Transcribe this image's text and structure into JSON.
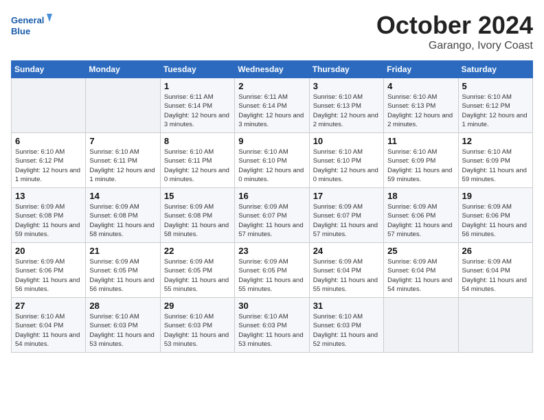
{
  "logo": {
    "text_general": "General",
    "text_blue": "Blue"
  },
  "title": {
    "month": "October 2024",
    "location": "Garango, Ivory Coast"
  },
  "headers": [
    "Sunday",
    "Monday",
    "Tuesday",
    "Wednesday",
    "Thursday",
    "Friday",
    "Saturday"
  ],
  "weeks": [
    [
      {
        "day": "",
        "content": ""
      },
      {
        "day": "",
        "content": ""
      },
      {
        "day": "1",
        "content": "Sunrise: 6:11 AM\nSunset: 6:14 PM\nDaylight: 12 hours and 3 minutes."
      },
      {
        "day": "2",
        "content": "Sunrise: 6:11 AM\nSunset: 6:14 PM\nDaylight: 12 hours and 3 minutes."
      },
      {
        "day": "3",
        "content": "Sunrise: 6:10 AM\nSunset: 6:13 PM\nDaylight: 12 hours and 2 minutes."
      },
      {
        "day": "4",
        "content": "Sunrise: 6:10 AM\nSunset: 6:13 PM\nDaylight: 12 hours and 2 minutes."
      },
      {
        "day": "5",
        "content": "Sunrise: 6:10 AM\nSunset: 6:12 PM\nDaylight: 12 hours and 1 minute."
      }
    ],
    [
      {
        "day": "6",
        "content": "Sunrise: 6:10 AM\nSunset: 6:12 PM\nDaylight: 12 hours and 1 minute."
      },
      {
        "day": "7",
        "content": "Sunrise: 6:10 AM\nSunset: 6:11 PM\nDaylight: 12 hours and 1 minute."
      },
      {
        "day": "8",
        "content": "Sunrise: 6:10 AM\nSunset: 6:11 PM\nDaylight: 12 hours and 0 minutes."
      },
      {
        "day": "9",
        "content": "Sunrise: 6:10 AM\nSunset: 6:10 PM\nDaylight: 12 hours and 0 minutes."
      },
      {
        "day": "10",
        "content": "Sunrise: 6:10 AM\nSunset: 6:10 PM\nDaylight: 12 hours and 0 minutes."
      },
      {
        "day": "11",
        "content": "Sunrise: 6:10 AM\nSunset: 6:09 PM\nDaylight: 11 hours and 59 minutes."
      },
      {
        "day": "12",
        "content": "Sunrise: 6:10 AM\nSunset: 6:09 PM\nDaylight: 11 hours and 59 minutes."
      }
    ],
    [
      {
        "day": "13",
        "content": "Sunrise: 6:09 AM\nSunset: 6:08 PM\nDaylight: 11 hours and 59 minutes."
      },
      {
        "day": "14",
        "content": "Sunrise: 6:09 AM\nSunset: 6:08 PM\nDaylight: 11 hours and 58 minutes."
      },
      {
        "day": "15",
        "content": "Sunrise: 6:09 AM\nSunset: 6:08 PM\nDaylight: 11 hours and 58 minutes."
      },
      {
        "day": "16",
        "content": "Sunrise: 6:09 AM\nSunset: 6:07 PM\nDaylight: 11 hours and 57 minutes."
      },
      {
        "day": "17",
        "content": "Sunrise: 6:09 AM\nSunset: 6:07 PM\nDaylight: 11 hours and 57 minutes."
      },
      {
        "day": "18",
        "content": "Sunrise: 6:09 AM\nSunset: 6:06 PM\nDaylight: 11 hours and 57 minutes."
      },
      {
        "day": "19",
        "content": "Sunrise: 6:09 AM\nSunset: 6:06 PM\nDaylight: 11 hours and 56 minutes."
      }
    ],
    [
      {
        "day": "20",
        "content": "Sunrise: 6:09 AM\nSunset: 6:06 PM\nDaylight: 11 hours and 56 minutes."
      },
      {
        "day": "21",
        "content": "Sunrise: 6:09 AM\nSunset: 6:05 PM\nDaylight: 11 hours and 56 minutes."
      },
      {
        "day": "22",
        "content": "Sunrise: 6:09 AM\nSunset: 6:05 PM\nDaylight: 11 hours and 55 minutes."
      },
      {
        "day": "23",
        "content": "Sunrise: 6:09 AM\nSunset: 6:05 PM\nDaylight: 11 hours and 55 minutes."
      },
      {
        "day": "24",
        "content": "Sunrise: 6:09 AM\nSunset: 6:04 PM\nDaylight: 11 hours and 55 minutes."
      },
      {
        "day": "25",
        "content": "Sunrise: 6:09 AM\nSunset: 6:04 PM\nDaylight: 11 hours and 54 minutes."
      },
      {
        "day": "26",
        "content": "Sunrise: 6:09 AM\nSunset: 6:04 PM\nDaylight: 11 hours and 54 minutes."
      }
    ],
    [
      {
        "day": "27",
        "content": "Sunrise: 6:10 AM\nSunset: 6:04 PM\nDaylight: 11 hours and 54 minutes."
      },
      {
        "day": "28",
        "content": "Sunrise: 6:10 AM\nSunset: 6:03 PM\nDaylight: 11 hours and 53 minutes."
      },
      {
        "day": "29",
        "content": "Sunrise: 6:10 AM\nSunset: 6:03 PM\nDaylight: 11 hours and 53 minutes."
      },
      {
        "day": "30",
        "content": "Sunrise: 6:10 AM\nSunset: 6:03 PM\nDaylight: 11 hours and 53 minutes."
      },
      {
        "day": "31",
        "content": "Sunrise: 6:10 AM\nSunset: 6:03 PM\nDaylight: 11 hours and 52 minutes."
      },
      {
        "day": "",
        "content": ""
      },
      {
        "day": "",
        "content": ""
      }
    ]
  ]
}
